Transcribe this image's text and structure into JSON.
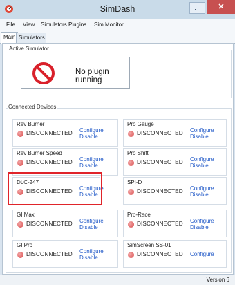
{
  "window": {
    "title": "SimDash",
    "close_glyph": "✕"
  },
  "menu": [
    {
      "label": "File"
    },
    {
      "label": "View"
    },
    {
      "label": "Simulators Plugins"
    },
    {
      "label": "Sim Monitor"
    }
  ],
  "tabs": [
    {
      "label": "Main",
      "selected": true
    },
    {
      "label": "Simulators",
      "selected": false
    }
  ],
  "active_simulator": {
    "heading": "Active Simulator",
    "icon": "no-entry-icon",
    "status": "No plugin running"
  },
  "connected_devices": {
    "heading": "Connected Devices",
    "devices": [
      {
        "name": "Rev Burner",
        "status": "DISCONNECTED",
        "configure": "Configure",
        "disable": "Disable"
      },
      {
        "name": "Pro Gauge",
        "status": "DISCONNECTED",
        "configure": "Configure",
        "disable": "Disable"
      },
      {
        "name": "Rev Burner Speed",
        "status": "DISCONNECTED",
        "configure": "Configure",
        "disable": "Disable"
      },
      {
        "name": "Pro Shift",
        "status": "DISCONNECTED",
        "configure": "Configure",
        "disable": "Disable"
      },
      {
        "name": "DLC-247",
        "status": "DISCONNECTED",
        "configure": "Configure",
        "disable": "Disable",
        "highlighted": true
      },
      {
        "name": "SPI-D",
        "status": "DISCONNECTED",
        "configure": "Configure",
        "disable": "Disable"
      },
      {
        "name": "GI Max",
        "status": "DISCONNECTED",
        "configure": "Configure",
        "disable": "Disable"
      },
      {
        "name": "Pro-Race",
        "status": "DISCONNECTED",
        "configure": "Configure",
        "disable": "Disable"
      },
      {
        "name": "GI Pro",
        "status": "DISCONNECTED",
        "configure": "Configure",
        "disable": "Disable"
      },
      {
        "name": "SimScreen SS-01",
        "status": "DISCONNECTED",
        "configure": "Configure"
      }
    ]
  },
  "statusbar": {
    "version": "Version 6"
  },
  "colors": {
    "link": "#1e57c7",
    "status_dot": "#d94848",
    "highlight": "#e0242a",
    "close": "#c75050"
  }
}
